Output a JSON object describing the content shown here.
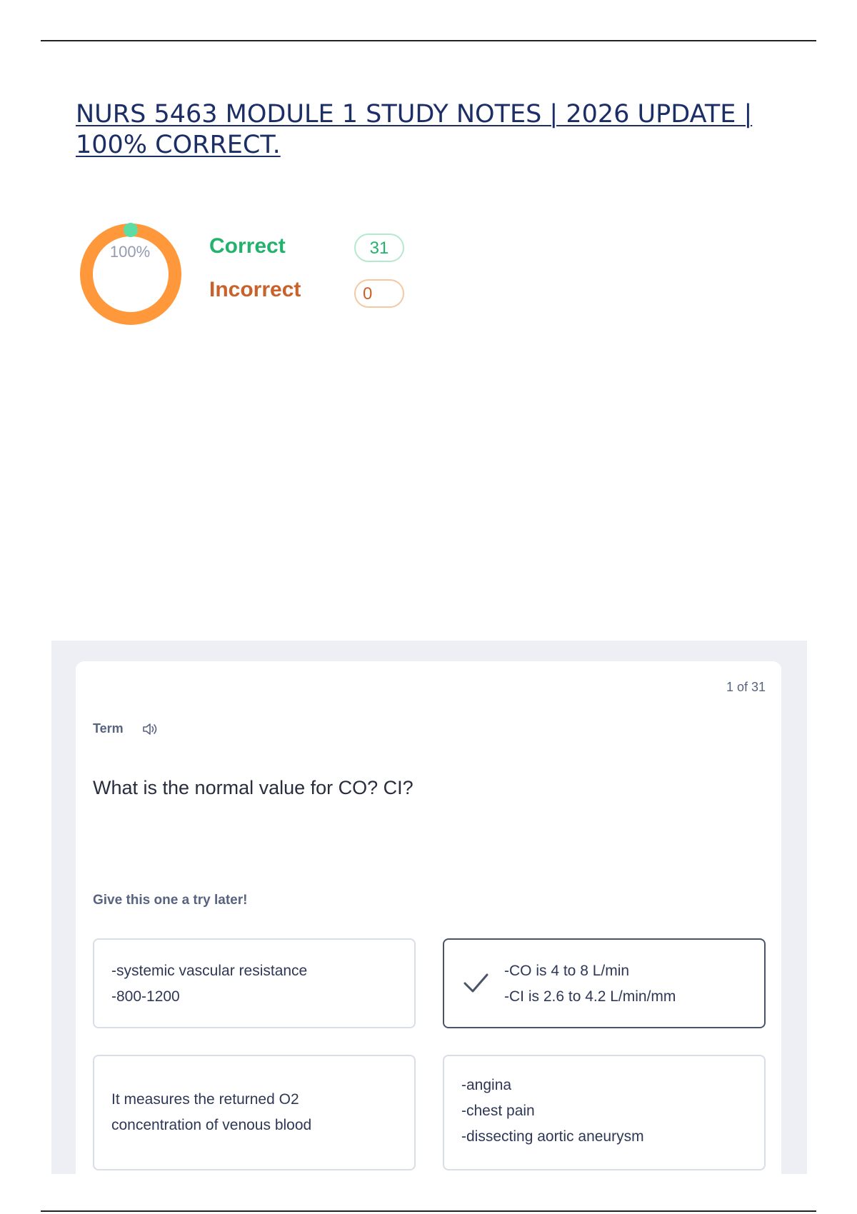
{
  "document": {
    "title": "NURS 5463 MODULE 1 STUDY NOTES | 2026 UPDATE | 100% CORRECT."
  },
  "score": {
    "percent_label": "100%",
    "percent_value": 100,
    "correct_label": "Correct",
    "correct_count": "31",
    "incorrect_label": "Incorrect",
    "incorrect_count": "0",
    "colors": {
      "correct": "#23b26d",
      "incorrect": "#c9622a",
      "ring": "#ff983a",
      "ring_marker": "#5fdca3"
    }
  },
  "flashcard": {
    "counter": "1 of 31",
    "term_label": "Term",
    "speaker_icon": "speaker-icon",
    "question": "What is the normal value for CO? CI?",
    "hint": "Give this one a try later!",
    "options": [
      {
        "lines": [
          "-systemic vascular resistance",
          "-800-1200"
        ],
        "selected": false
      },
      {
        "lines": [
          "-CO is 4 to 8 L/min",
          "-CI is 2.6 to 4.2 L/min/mm"
        ],
        "selected": true,
        "icon": "checkmark-icon"
      },
      {
        "lines": [
          "It measures the returned O2",
          "concentration of venous blood"
        ],
        "selected": false
      },
      {
        "lines": [
          "-angina",
          "-chest pain",
          "-dissecting aortic aneurysm"
        ],
        "selected": false
      }
    ]
  }
}
